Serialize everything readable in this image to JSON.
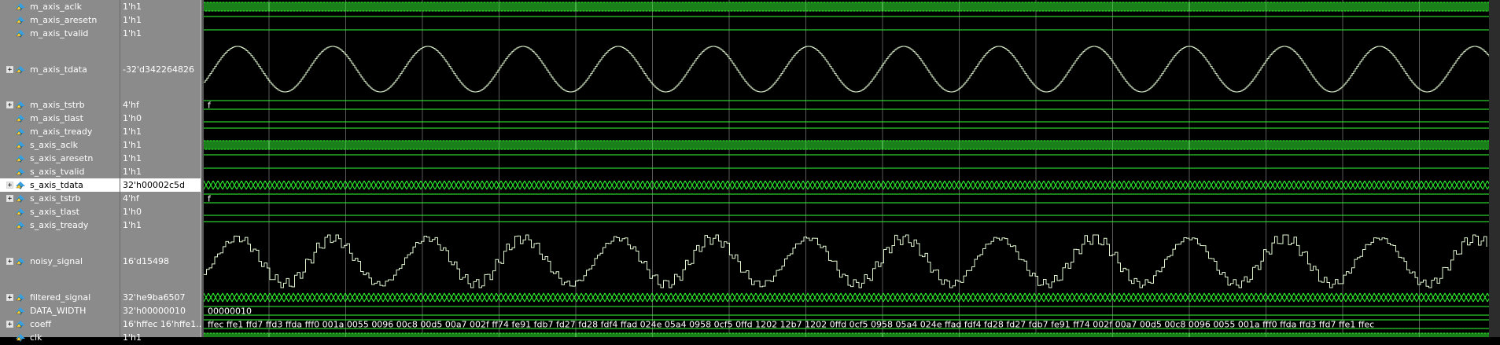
{
  "colors": {
    "wave": "#33ff33",
    "analog": "#e0f5d0",
    "grid": "#5a5a5a",
    "panel": "#8b8b8b"
  },
  "signals": [
    {
      "name": "m_axis_aclk",
      "value": "1'h1",
      "type": "clock",
      "expandable": false
    },
    {
      "name": "m_axis_aresetn",
      "value": "1'h1",
      "type": "high",
      "expandable": false
    },
    {
      "name": "m_axis_tvalid",
      "value": "1'h1",
      "type": "high",
      "expandable": false
    },
    {
      "name": "m_axis_tdata",
      "value": "-32'd342264826",
      "type": "analog",
      "expandable": true
    },
    {
      "name": "m_axis_tstrb",
      "value": "4'hf",
      "type": "bus",
      "expandable": true,
      "bus_text": "f"
    },
    {
      "name": "m_axis_tlast",
      "value": "1'h0",
      "type": "low",
      "expandable": false
    },
    {
      "name": "m_axis_tready",
      "value": "1'h1",
      "type": "high",
      "expandable": false
    },
    {
      "name": "s_axis_aclk",
      "value": "1'h1",
      "type": "clock",
      "expandable": false
    },
    {
      "name": "s_axis_aresetn",
      "value": "1'h1",
      "type": "high",
      "expandable": false
    },
    {
      "name": "s_axis_tvalid",
      "value": "1'h1",
      "type": "high",
      "expandable": false
    },
    {
      "name": "s_axis_tdata",
      "value": "32'h00002c5d",
      "type": "busdense",
      "expandable": true,
      "selected": true
    },
    {
      "name": "s_axis_tstrb",
      "value": "4'hf",
      "type": "bus",
      "expandable": true,
      "bus_text": "f"
    },
    {
      "name": "s_axis_tlast",
      "value": "1'h0",
      "type": "low",
      "expandable": false
    },
    {
      "name": "s_axis_tready",
      "value": "1'h1",
      "type": "high",
      "expandable": false
    },
    {
      "name": "noisy_signal",
      "value": "16'd15498",
      "type": "analog_noisy",
      "expandable": true
    },
    {
      "name": "filtered_signal",
      "value": "32'he9ba6507",
      "type": "busdense",
      "expandable": true
    },
    {
      "name": "DATA_WIDTH",
      "value": "32'h00000010",
      "type": "bus",
      "expandable": false,
      "bus_text": "00000010"
    },
    {
      "name": "coeff",
      "value": "16'hffec 16'hffe1...",
      "type": "bus",
      "expandable": true,
      "bus_text": "ffec ffe1 ffd7 ffd3 ffda fff0 001a 0055 0096 00c8 00d5 00a7 002f ff74 fe91 fdb7 fd27 fd28 fdf4 ffad 024e 05a4 0958 0cf5 0ffd 1202 12b7 1202 0ffd 0cf5 0958 05a4 024e ffad fdf4 fd28 fd27 fdb7 fe91 ff74 002f 00a7 00d5 00c8 0096 0055 001a fff0 ffda ffd3 ffd7 ffe1 ffec"
    },
    {
      "name": "clk",
      "value": "1'h1",
      "type": "clock",
      "expandable": false
    }
  ]
}
